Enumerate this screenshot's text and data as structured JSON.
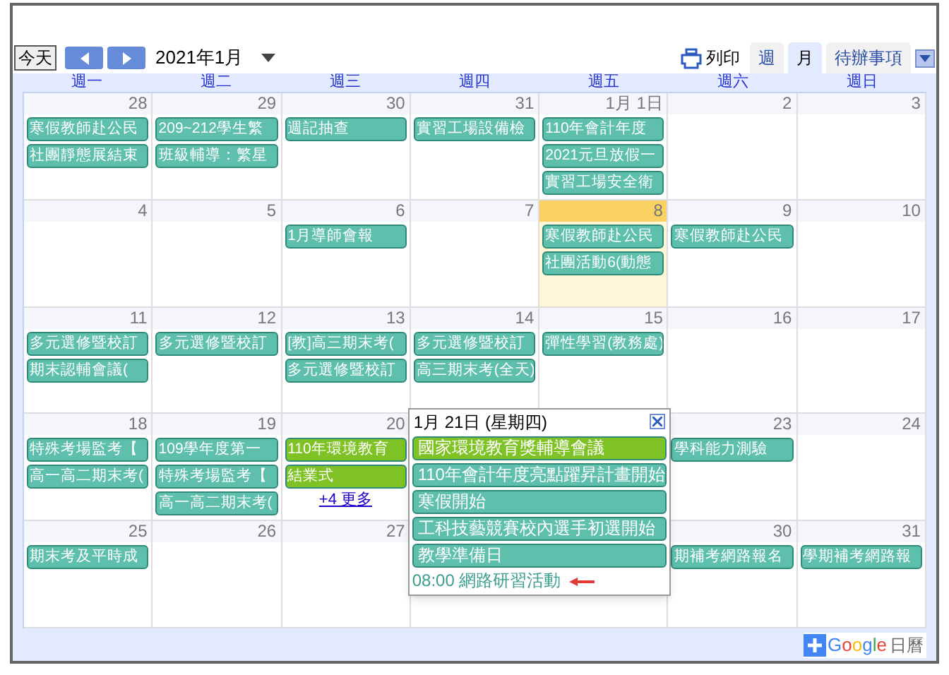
{
  "toolbar": {
    "today_button": "今天",
    "month_title": "2021年1月",
    "print_label": "列印",
    "view_tabs": [
      {
        "label": "週",
        "selected": false
      },
      {
        "label": "月",
        "selected": true
      },
      {
        "label": "待辦事項",
        "selected": false
      }
    ]
  },
  "weekdays": [
    "週一",
    "週二",
    "週三",
    "週四",
    "週五",
    "週六",
    "週日"
  ],
  "weeks": [
    {
      "days": [
        {
          "date": "28",
          "today": false,
          "events": [
            {
              "title": "寒假教師赴公民",
              "color": "#5ebfad"
            },
            {
              "title": "社團靜態展結束",
              "color": "#5ebfad"
            }
          ]
        },
        {
          "date": "29",
          "today": false,
          "events": [
            {
              "title": "209~212學生繁",
              "color": "#5ebfad"
            },
            {
              "title": "班級輔導：繁星",
              "color": "#5ebfad"
            }
          ]
        },
        {
          "date": "30",
          "today": false,
          "events": [
            {
              "title": "週記抽查",
              "color": "#5ebfad"
            }
          ]
        },
        {
          "date": "31",
          "today": false,
          "events": [
            {
              "title": "實習工場設備檢",
              "color": "#5ebfad"
            }
          ]
        },
        {
          "date": "1月 1日",
          "today": false,
          "events": [
            {
              "title": "110年會計年度",
              "color": "#5ebfad"
            },
            {
              "title": "2021元旦放假一",
              "color": "#5ebfad"
            },
            {
              "title": "實習工場安全衛",
              "color": "#5ebfad"
            }
          ]
        },
        {
          "date": "2",
          "today": false
        },
        {
          "date": "3",
          "today": false
        }
      ]
    },
    {
      "days": [
        {
          "date": "4",
          "today": false
        },
        {
          "date": "5",
          "today": false
        },
        {
          "date": "6",
          "today": false,
          "events": [
            {
              "title": "1月導師會報",
              "color": "#5ebfad"
            }
          ]
        },
        {
          "date": "7",
          "today": false
        },
        {
          "date": "8",
          "today": true,
          "events": [
            {
              "title": "寒假教師赴公民",
              "color": "#5ebfad"
            },
            {
              "title": "社團活動6(動態",
              "color": "#5ebfad"
            }
          ]
        },
        {
          "date": "9",
          "today": false,
          "events": [
            {
              "title": "寒假教師赴公民",
              "color": "#5ebfad"
            }
          ]
        },
        {
          "date": "10",
          "today": false
        }
      ]
    },
    {
      "days": [
        {
          "date": "11",
          "today": false,
          "events": [
            {
              "title": "多元選修暨校訂",
              "color": "#5ebfad"
            },
            {
              "title": "期末認輔會議(",
              "color": "#5ebfad"
            }
          ]
        },
        {
          "date": "12",
          "today": false,
          "events": [
            {
              "title": "多元選修暨校訂",
              "color": "#5ebfad"
            }
          ]
        },
        {
          "date": "13",
          "today": false,
          "events": [
            {
              "title": "[教]高三期末考(",
              "color": "#5ebfad"
            },
            {
              "title": "多元選修暨校訂",
              "color": "#5ebfad"
            }
          ]
        },
        {
          "date": "14",
          "today": false,
          "events": [
            {
              "title": "多元選修暨校訂",
              "color": "#5ebfad"
            },
            {
              "title": "高三期末考(全天)",
              "color": "#5ebfad"
            }
          ]
        },
        {
          "date": "15",
          "today": false,
          "events": [
            {
              "title": "彈性學習(教務處)",
              "color": "#5ebfad"
            }
          ]
        },
        {
          "date": "16",
          "today": false
        },
        {
          "date": "17",
          "today": false
        }
      ]
    },
    {
      "days": [
        {
          "date": "18",
          "today": false,
          "events": [
            {
              "title": "特殊考場監考【",
              "color": "#5ebfad"
            },
            {
              "title": "高一高二期末考(",
              "color": "#5ebfad"
            }
          ]
        },
        {
          "date": "19",
          "today": false,
          "events": [
            {
              "title": "109學年度第一",
              "color": "#5ebfad"
            },
            {
              "title": "特殊考場監考【",
              "color": "#5ebfad"
            },
            {
              "title": "高一高二期末考(",
              "color": "#5ebfad"
            }
          ]
        },
        {
          "date": "20",
          "today": false,
          "events": [
            {
              "title": "110年環境教育",
              "color": "#7ec225"
            },
            {
              "title": "結業式",
              "color": "#7ec225"
            }
          ],
          "more": "+4 更多"
        },
        {
          "date": "23",
          "today": false,
          "events": [
            {
              "title": "學科能力測驗",
              "color": "#5ebfad"
            }
          ]
        },
        {
          "date": "24",
          "today": false
        }
      ]
    },
    {
      "days": [
        {
          "date": "25",
          "today": false,
          "events": [
            {
              "title": "期末考及平時成",
              "color": "#5ebfad"
            }
          ]
        },
        {
          "date": "26",
          "today": false
        },
        {
          "date": "27",
          "today": false
        },
        {
          "date": "30",
          "today": false,
          "events": [
            {
              "title": "期補考網路報名",
              "color": "#5ebfad"
            }
          ]
        },
        {
          "date": "31",
          "today": false,
          "events": [
            {
              "title": "學期補考網路報",
              "color": "#5ebfad"
            }
          ]
        }
      ]
    }
  ],
  "popup": {
    "title": "1月 21日 (星期四)",
    "events": [
      {
        "title": "國家環境教育獎輔導會議",
        "color": "#7ec225"
      },
      {
        "title": "110年會計年度亮點躍昇計畫開始",
        "color": "#5ebfad"
      },
      {
        "title": "寒假開始",
        "color": "#5ebfad"
      },
      {
        "title": "工科技藝競賽校內選手初選開始",
        "color": "#5ebfad"
      },
      {
        "title": "教學準備日",
        "color": "#5ebfad"
      }
    ],
    "timed_event": {
      "time": "08:00",
      "title": "網路研習活動",
      "color": "#3a9e8c"
    }
  },
  "footer": {
    "logo": "Google",
    "product": "日曆"
  }
}
